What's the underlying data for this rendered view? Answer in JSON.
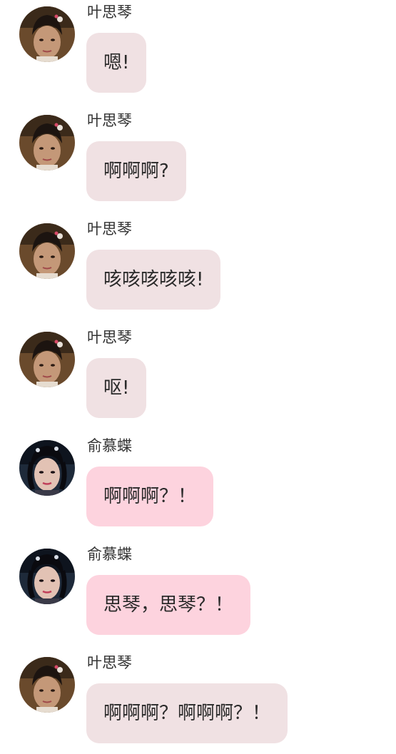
{
  "colors": {
    "bubble_ye": "#f0e1e3",
    "bubble_yu": "#fdd3de",
    "sender_text": "#333333",
    "message_text": "#2a2a2a"
  },
  "messages": [
    {
      "sender": "叶思琴",
      "avatar": "ye-sijin-avatar",
      "text": "嗯!"
    },
    {
      "sender": "叶思琴",
      "avatar": "ye-sijin-avatar",
      "text": "啊啊啊?"
    },
    {
      "sender": "叶思琴",
      "avatar": "ye-sijin-avatar",
      "text": "咳咳咳咳咳!"
    },
    {
      "sender": "叶思琴",
      "avatar": "ye-sijin-avatar",
      "text": "呕!"
    },
    {
      "sender": "俞慕蝶",
      "avatar": "yu-mudie-avatar",
      "text": "啊啊啊？！"
    },
    {
      "sender": "俞慕蝶",
      "avatar": "yu-mudie-avatar",
      "text": "思琴，思琴？！"
    },
    {
      "sender": "叶思琴",
      "avatar": "ye-sijin-avatar",
      "text": "啊啊啊？啊啊啊？！"
    }
  ]
}
